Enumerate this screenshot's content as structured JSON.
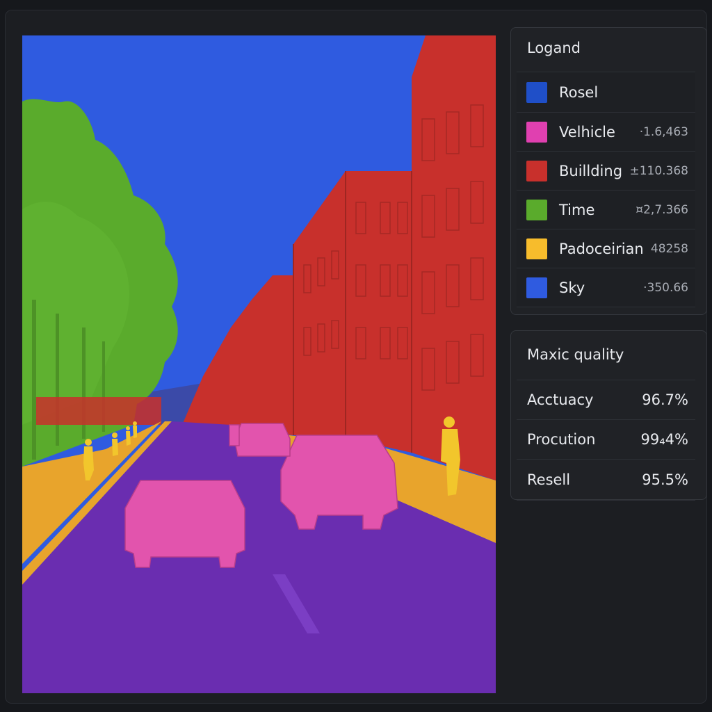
{
  "legend": {
    "title": "Logand",
    "items": [
      {
        "label": "Rosel",
        "value": "",
        "color": "#1f4fc8"
      },
      {
        "label": "Velhicle",
        "value": "·1.6,463",
        "color": "#e040b0"
      },
      {
        "label": "Buillding",
        "value": "±110.368",
        "color": "#c8302c"
      },
      {
        "label": "Time",
        "value": "¤2,7.366",
        "color": "#5aab2c"
      },
      {
        "label": "Padoceirian",
        "value": "48258",
        "color": "#f7bc2c"
      },
      {
        "label": "Sky",
        "value": "·350.66",
        "color": "#2f5be0"
      }
    ]
  },
  "quality": {
    "title": "Maxic quality",
    "metrics": [
      {
        "label": "Acctuacy",
        "value": "96.7%"
      },
      {
        "label": "Procution",
        "value": "99₄4%"
      },
      {
        "label": "Resell",
        "value": "95.5%"
      }
    ]
  },
  "segmentation_colors": {
    "sky": "#2f5be0",
    "road": "#6a2db0",
    "building": "#c8302c",
    "tree": "#5aab2c",
    "sidewalk": "#e8a42c",
    "vehicle": "#e254ad",
    "pedestrian": "#f2c62c"
  }
}
